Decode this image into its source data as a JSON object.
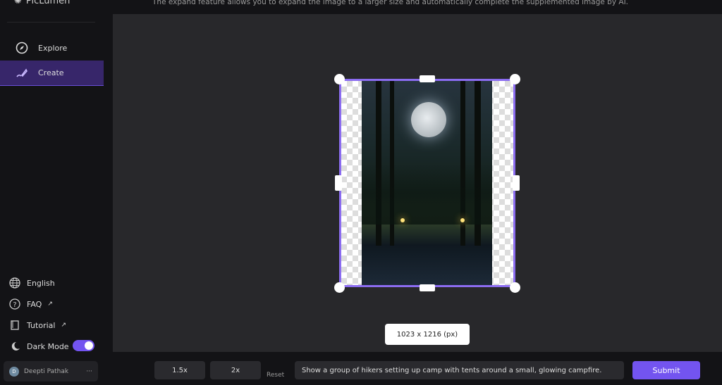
{
  "app": {
    "name": "PicLumen"
  },
  "header": {
    "description": "The expand feature allows you to expand the image to a larger size and automatically complete the supplemented image by AI."
  },
  "sidebar": {
    "nav": [
      {
        "label": "Explore",
        "icon": "compass-icon"
      },
      {
        "label": "Create",
        "icon": "brush-icon",
        "active": true
      }
    ],
    "bottom": [
      {
        "label": "English",
        "icon": "globe-icon"
      },
      {
        "label": "FAQ",
        "icon": "help-icon",
        "external": true
      },
      {
        "label": "Tutorial",
        "icon": "book-icon",
        "external": true
      }
    ],
    "dark_mode": {
      "label": "Dark Mode",
      "on": true
    },
    "user": {
      "name": "Deepti Pathak",
      "initial": "D"
    }
  },
  "canvas": {
    "size_label": "1023 x 1216 (px)"
  },
  "toolbar": {
    "scale_1": "1.5x",
    "scale_2": "2x",
    "reset": "Reset",
    "prompt": "Show a group of hikers setting up camp with tents around a small, glowing campfire.",
    "submit": "Submit"
  },
  "colors": {
    "accent": "#7354f0",
    "active_nav": "#37266a"
  }
}
